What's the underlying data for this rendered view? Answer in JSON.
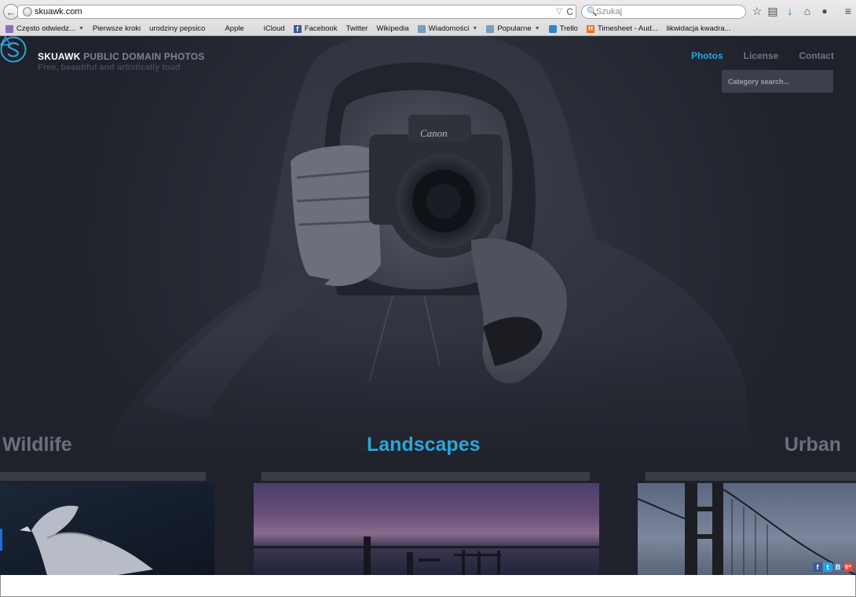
{
  "browser": {
    "back_glyph": "←",
    "url": "skuawk.com",
    "url_dropdown_glyph": "▽",
    "reload_glyph": "C",
    "search_placeholder": "Szukaj",
    "search_glyph": "🔍",
    "toolbar_icons": {
      "bookmark_star": "☆",
      "reading_list": "▤",
      "download": "↓",
      "home": "⌂",
      "chat": "●",
      "menu": "≡"
    },
    "bookmarks": [
      {
        "label": "Często odwiedz...",
        "icon": "folder-purple-icon",
        "has_dropdown": true
      },
      {
        "label": "Pierwsze kroki",
        "icon": "page-icon"
      },
      {
        "label": "urodziny pepsico",
        "icon": "page-icon"
      },
      {
        "label": "Apple",
        "icon": "apple-icon"
      },
      {
        "label": "iCloud",
        "icon": "apple-icon"
      },
      {
        "label": "Facebook",
        "icon": "facebook-icon"
      },
      {
        "label": "Twitter",
        "icon": "page-icon"
      },
      {
        "label": "Wikipedia",
        "icon": "page-icon"
      },
      {
        "label": "Wiadomości",
        "icon": "folder-icon",
        "has_dropdown": true
      },
      {
        "label": "Popularne",
        "icon": "folder-icon",
        "has_dropdown": true
      },
      {
        "label": "Trello",
        "icon": "trello-icon"
      },
      {
        "label": "Timesheet - Aud...",
        "icon": "harvest-icon"
      },
      {
        "label": "likwidacja kwadra...",
        "icon": "page-icon"
      }
    ],
    "bookmark_glyphs": {
      "apple": "",
      "facebook": "f",
      "harvest": "H",
      "caret": "▼"
    }
  },
  "site": {
    "brand_name": "SKUAWK",
    "brand_sub": "PUBLIC DOMAIN PHOTOS",
    "tagline": "Free, beautiful and artistically loud",
    "nav": [
      {
        "label": "Photos",
        "active": true
      },
      {
        "label": "License",
        "active": false
      },
      {
        "label": "Contact",
        "active": false
      }
    ],
    "category_search_placeholder": "Category search...",
    "categories": {
      "left": "Wildlife",
      "center": "Landscapes",
      "right": "Urban"
    },
    "social": [
      "f",
      "t",
      "B",
      "g+"
    ]
  },
  "colors": {
    "accent": "#2ba6d8",
    "nav_inactive": "#6f7585",
    "background": "#1f212b",
    "facebook": "#3b5998",
    "twitter": "#1da1f2",
    "vk": "#4a76a8",
    "gplus": "#dd4b39"
  }
}
